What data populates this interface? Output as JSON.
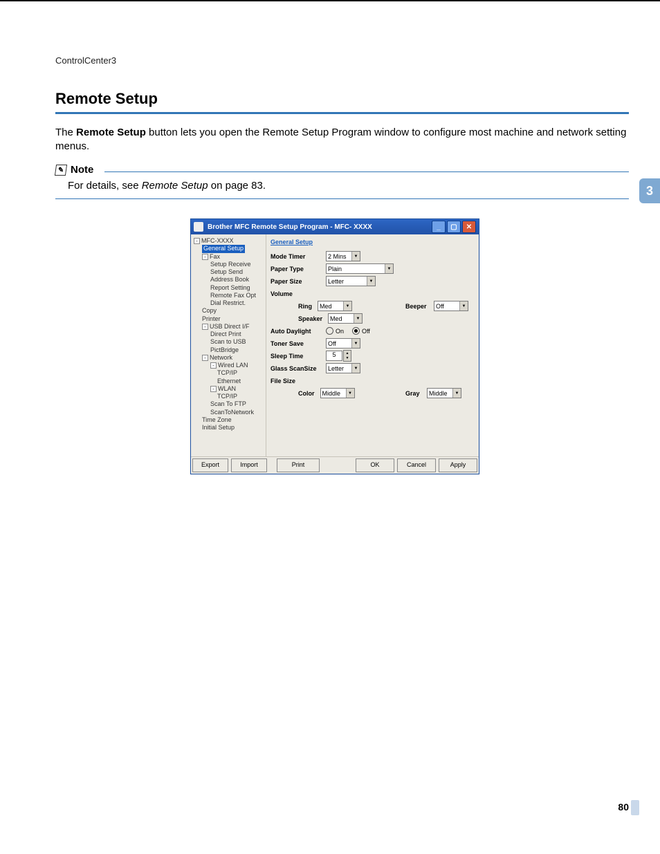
{
  "header": {
    "section": "ControlCenter3"
  },
  "heading": "Remote Setup",
  "intro": {
    "prefix": "The ",
    "bold": "Remote Setup",
    "suffix": " button lets you open the Remote Setup Program window to configure most machine and network setting menus."
  },
  "note": {
    "label": "Note",
    "text_prefix": "For details, see ",
    "text_italic": "Remote Setup",
    "text_suffix": " on page 83."
  },
  "sidetab": "3",
  "page_number": "80",
  "dialog": {
    "title": "Brother MFC Remote Setup Program - MFC- XXXX",
    "tree": {
      "root": "MFC-XXXX",
      "selected": "General Setup",
      "items": [
        {
          "l": 1,
          "t": "Fax",
          "tog": "-"
        },
        {
          "l": 2,
          "t": "Setup Receive"
        },
        {
          "l": 2,
          "t": "Setup Send"
        },
        {
          "l": 2,
          "t": "Address Book"
        },
        {
          "l": 2,
          "t": "Report Setting"
        },
        {
          "l": 2,
          "t": "Remote Fax Opt"
        },
        {
          "l": 2,
          "t": "Dial Restrict."
        },
        {
          "l": 1,
          "t": "Copy"
        },
        {
          "l": 1,
          "t": "Printer"
        },
        {
          "l": 1,
          "t": "USB Direct I/F",
          "tog": "-"
        },
        {
          "l": 2,
          "t": "Direct Print"
        },
        {
          "l": 2,
          "t": "Scan to USB"
        },
        {
          "l": 2,
          "t": "PictBridge"
        },
        {
          "l": 1,
          "t": "Network",
          "tog": "-"
        },
        {
          "l": 2,
          "t": "Wired LAN",
          "tog": "-"
        },
        {
          "l": 2,
          "t": "TCP/IP",
          "extra": 1
        },
        {
          "l": 2,
          "t": "Ethernet",
          "extra": 1
        },
        {
          "l": 2,
          "t": "WLAN",
          "tog": "-"
        },
        {
          "l": 2,
          "t": "TCP/IP",
          "extra": 1
        },
        {
          "l": 2,
          "t": "Scan To FTP"
        },
        {
          "l": 2,
          "t": "ScanToNetwork"
        },
        {
          "l": 1,
          "t": "Time Zone"
        },
        {
          "l": 1,
          "t": "Initial Setup"
        }
      ]
    },
    "panel": {
      "title": "General Setup",
      "labels": {
        "mode_timer": "Mode Timer",
        "paper_type": "Paper Type",
        "paper_size": "Paper Size",
        "volume": "Volume",
        "ring": "Ring",
        "beeper": "Beeper",
        "speaker": "Speaker",
        "auto_daylight": "Auto Daylight",
        "on": "On",
        "off": "Off",
        "toner_save": "Toner Save",
        "sleep_time": "Sleep Time",
        "glass_scan": "Glass ScanSize",
        "file_size": "File Size",
        "color": "Color",
        "gray": "Gray"
      },
      "values": {
        "mode_timer": "2 Mins",
        "paper_type": "Plain",
        "paper_size": "Letter",
        "ring": "Med",
        "beeper": "Off",
        "speaker": "Med",
        "daylight": "Off",
        "toner_save": "Off",
        "sleep_time": "5",
        "glass_scan": "Letter",
        "color": "Middle",
        "gray": "Middle"
      }
    },
    "buttons": {
      "export": "Export",
      "import": "Import",
      "print": "Print",
      "ok": "OK",
      "cancel": "Cancel",
      "apply": "Apply"
    }
  }
}
